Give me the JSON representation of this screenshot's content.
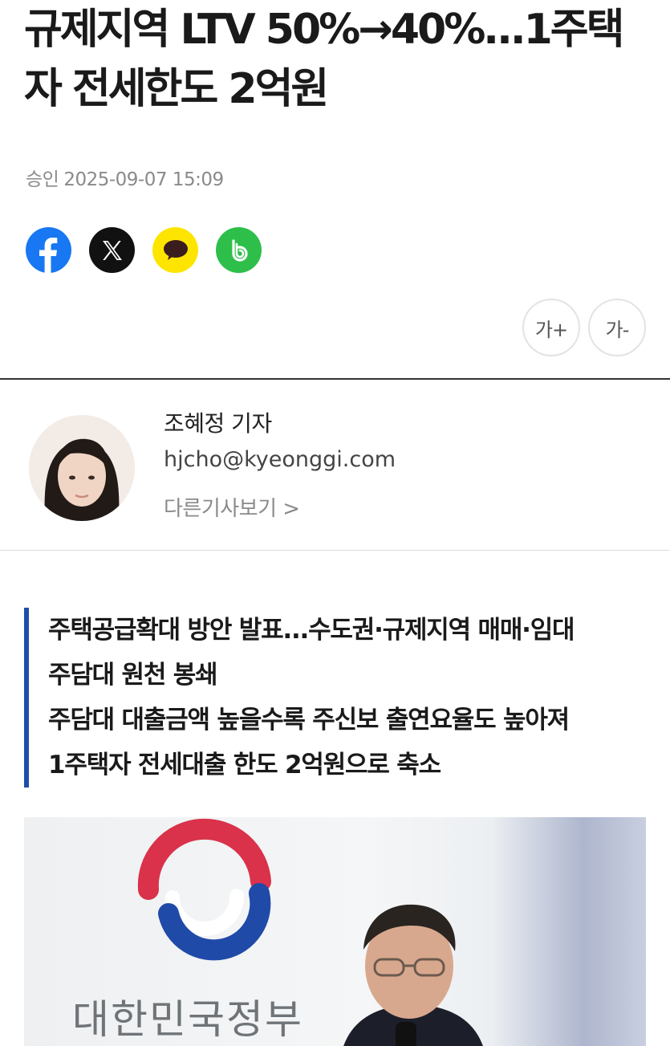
{
  "article": {
    "headline_line1": "규제지역 LTV 50%→40%...1주택",
    "headline_line2": "자 전세한도 2억원",
    "approval_label": "승인",
    "approval_datetime": "2025-09-07 15:09"
  },
  "share": {
    "buttons": [
      {
        "icon": "facebook-icon",
        "color": "#1877f2"
      },
      {
        "icon": "x-icon",
        "color": "#111111"
      },
      {
        "icon": "kakaotalk-icon",
        "color": "#fee500"
      },
      {
        "icon": "band-icon",
        "color": "#2dbf4a"
      }
    ]
  },
  "font_controls": {
    "increase_label": "가+",
    "decrease_label": "가-"
  },
  "reporter": {
    "name": "조혜정 기자",
    "email": "hjcho@kyeonggi.com",
    "more_link": "다른기사보기 >"
  },
  "subheadlines": [
    "주택공급확대 방안 발표...수도권·규제지역 매매·임대",
    "주담대 원천 봉쇄",
    "주담대 대출금액 높을수록 주신보 출연요율도 높아져",
    "1주택자 전세대출 한도 2억원으로 축소"
  ],
  "photo": {
    "backdrop_text": "대한민국정부"
  },
  "colors": {
    "accent_bar": "#1e4fa8",
    "meta_gray": "#8a8a8a"
  }
}
